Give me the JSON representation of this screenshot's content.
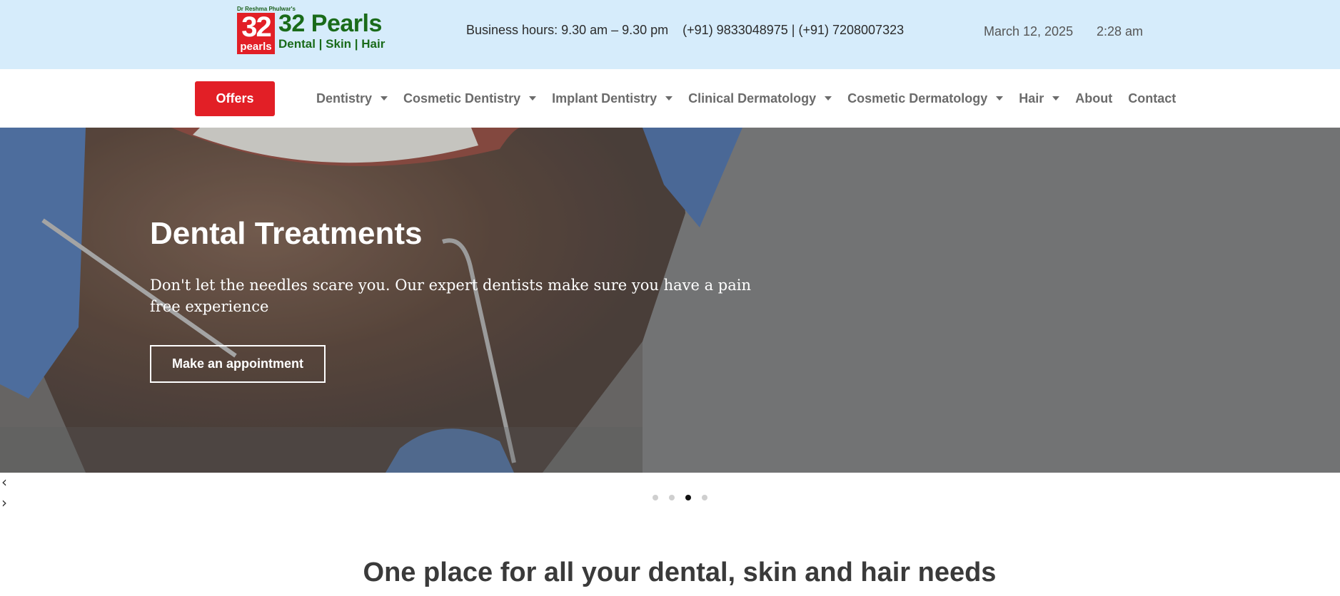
{
  "header": {
    "logo": {
      "doctor": "Dr Reshma Phulwar's",
      "badge_number": "32",
      "badge_sub": "pearls",
      "brand": "32 Pearls",
      "tagline": "Dental | Skin | Hair"
    },
    "business_hours": "Business hours: 9.30 am – 9.30 pm    (+91) 9833048975 | (+91) 7208007323",
    "date": "March 12, 2025",
    "time": "2:28 am"
  },
  "nav": {
    "offers_label": "Offers",
    "items": [
      {
        "label": "Dentistry",
        "dropdown": true
      },
      {
        "label": "Cosmetic Dentistry",
        "dropdown": true
      },
      {
        "label": "Implant Dentistry",
        "dropdown": true
      },
      {
        "label": "Clinical Dermatology",
        "dropdown": true
      },
      {
        "label": "Cosmetic Dermatology",
        "dropdown": true
      },
      {
        "label": "Hair",
        "dropdown": true
      },
      {
        "label": "About",
        "dropdown": false
      },
      {
        "label": "Contact",
        "dropdown": false
      }
    ]
  },
  "hero": {
    "title": "Dental Treatments",
    "text": "Don't let the needles scare you. Our expert dentists make sure you have a pain free experience",
    "button_label": "Make an appointment"
  },
  "slider": {
    "prev_icon": "chevron-left-icon",
    "next_icon": "chevron-right-icon",
    "dot_count": 4,
    "active_dot": 3
  },
  "section": {
    "title": "One place for all your dental, skin and hair needs"
  },
  "colors": {
    "topbar_bg": "#d6ecfb",
    "accent_red": "#e21f26",
    "brand_green": "#1a6b1a",
    "nav_text": "#6b6b6b"
  }
}
